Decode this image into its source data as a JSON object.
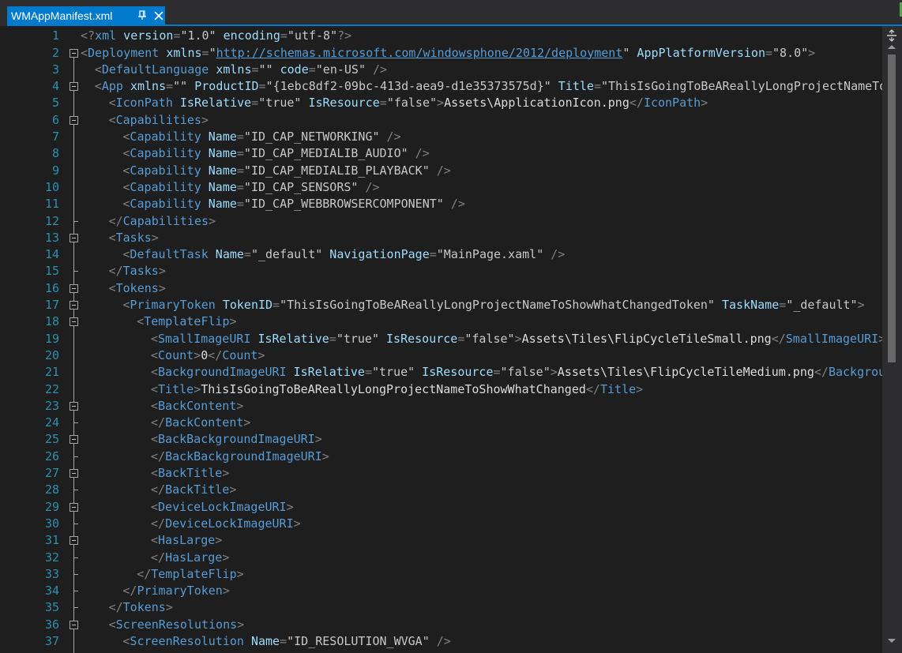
{
  "tab": {
    "title": "WMAppManifest.xml",
    "pin_icon": "pin-icon",
    "close_icon": "close-icon"
  },
  "colors": {
    "accent": "#007acc",
    "tag": "#569cd6",
    "attribute": "#9cdcfe",
    "delimiter": "#808080",
    "line_number": "#2b91af",
    "background": "#1e1e1e"
  },
  "editor": {
    "lines": [
      {
        "n": "1",
        "indent": 0,
        "fold": "",
        "tokens": [
          [
            "d",
            "<?"
          ],
          [
            "t",
            "xml"
          ],
          [
            "a",
            " version"
          ],
          [
            "d",
            "="
          ],
          [
            "s",
            "\"1.0\""
          ],
          [
            "a",
            " encoding"
          ],
          [
            "d",
            "="
          ],
          [
            "s",
            "\"utf-8\""
          ],
          [
            "d",
            "?>"
          ]
        ]
      },
      {
        "n": "2",
        "indent": 0,
        "fold": "open",
        "tokens": [
          [
            "d",
            "<"
          ],
          [
            "t",
            "Deployment"
          ],
          [
            "a",
            " xmlns"
          ],
          [
            "d",
            "="
          ],
          [
            "s",
            "\""
          ],
          [
            "u",
            "http://schemas.microsoft.com/windowsphone/2012/deployment"
          ],
          [
            "s",
            "\""
          ],
          [
            "a",
            " AppPlatformVersion"
          ],
          [
            "d",
            "="
          ],
          [
            "s",
            "\"8.0\""
          ],
          [
            "d",
            ">"
          ]
        ]
      },
      {
        "n": "3",
        "indent": 1,
        "fold": "",
        "tokens": [
          [
            "d",
            "<"
          ],
          [
            "t",
            "DefaultLanguage"
          ],
          [
            "a",
            " xmlns"
          ],
          [
            "d",
            "="
          ],
          [
            "s",
            "\"\""
          ],
          [
            "a",
            " code"
          ],
          [
            "d",
            "="
          ],
          [
            "s",
            "\"en-US\""
          ],
          [
            "d",
            " />"
          ]
        ]
      },
      {
        "n": "4",
        "indent": 1,
        "fold": "open",
        "tokens": [
          [
            "d",
            "<"
          ],
          [
            "t",
            "App"
          ],
          [
            "a",
            " xmlns"
          ],
          [
            "d",
            "="
          ],
          [
            "s",
            "\"\""
          ],
          [
            "a",
            " ProductID"
          ],
          [
            "d",
            "="
          ],
          [
            "s",
            "\"{1ebc8df2-09bc-413d-aea9-d1e35373575d}\""
          ],
          [
            "a",
            " Title"
          ],
          [
            "d",
            "="
          ],
          [
            "s",
            "\"ThisIsGoingToBeAReallyLongProjectNameToShowWhatChanged\""
          ]
        ]
      },
      {
        "n": "5",
        "indent": 2,
        "fold": "",
        "tokens": [
          [
            "d",
            "<"
          ],
          [
            "t",
            "IconPath"
          ],
          [
            "a",
            " IsRelative"
          ],
          [
            "d",
            "="
          ],
          [
            "s",
            "\"true\""
          ],
          [
            "a",
            " IsResource"
          ],
          [
            "d",
            "="
          ],
          [
            "s",
            "\"false\""
          ],
          [
            "d",
            ">"
          ],
          [
            "x",
            "Assets\\ApplicationIcon.png"
          ],
          [
            "d",
            "</"
          ],
          [
            "t",
            "IconPath"
          ],
          [
            "d",
            ">"
          ]
        ]
      },
      {
        "n": "6",
        "indent": 2,
        "fold": "open",
        "tokens": [
          [
            "d",
            "<"
          ],
          [
            "t",
            "Capabilities"
          ],
          [
            "d",
            ">"
          ]
        ]
      },
      {
        "n": "7",
        "indent": 3,
        "fold": "",
        "tokens": [
          [
            "d",
            "<"
          ],
          [
            "t",
            "Capability"
          ],
          [
            "a",
            " Name"
          ],
          [
            "d",
            "="
          ],
          [
            "s",
            "\"ID_CAP_NETWORKING\""
          ],
          [
            "d",
            " />"
          ]
        ]
      },
      {
        "n": "8",
        "indent": 3,
        "fold": "",
        "tokens": [
          [
            "d",
            "<"
          ],
          [
            "t",
            "Capability"
          ],
          [
            "a",
            " Name"
          ],
          [
            "d",
            "="
          ],
          [
            "s",
            "\"ID_CAP_MEDIALIB_AUDIO\""
          ],
          [
            "d",
            " />"
          ]
        ]
      },
      {
        "n": "9",
        "indent": 3,
        "fold": "",
        "tokens": [
          [
            "d",
            "<"
          ],
          [
            "t",
            "Capability"
          ],
          [
            "a",
            " Name"
          ],
          [
            "d",
            "="
          ],
          [
            "s",
            "\"ID_CAP_MEDIALIB_PLAYBACK\""
          ],
          [
            "d",
            " />"
          ]
        ]
      },
      {
        "n": "10",
        "indent": 3,
        "fold": "",
        "tokens": [
          [
            "d",
            "<"
          ],
          [
            "t",
            "Capability"
          ],
          [
            "a",
            " Name"
          ],
          [
            "d",
            "="
          ],
          [
            "s",
            "\"ID_CAP_SENSORS\""
          ],
          [
            "d",
            " />"
          ]
        ]
      },
      {
        "n": "11",
        "indent": 3,
        "fold": "",
        "tokens": [
          [
            "d",
            "<"
          ],
          [
            "t",
            "Capability"
          ],
          [
            "a",
            " Name"
          ],
          [
            "d",
            "="
          ],
          [
            "s",
            "\"ID_CAP_WEBBROWSERCOMPONENT\""
          ],
          [
            "d",
            " />"
          ]
        ]
      },
      {
        "n": "12",
        "indent": 2,
        "fold": "end",
        "tokens": [
          [
            "d",
            "</"
          ],
          [
            "t",
            "Capabilities"
          ],
          [
            "d",
            ">"
          ]
        ]
      },
      {
        "n": "13",
        "indent": 2,
        "fold": "open",
        "tokens": [
          [
            "d",
            "<"
          ],
          [
            "t",
            "Tasks"
          ],
          [
            "d",
            ">"
          ]
        ]
      },
      {
        "n": "14",
        "indent": 3,
        "fold": "",
        "tokens": [
          [
            "d",
            "<"
          ],
          [
            "t",
            "DefaultTask"
          ],
          [
            "a",
            " Name"
          ],
          [
            "d",
            "="
          ],
          [
            "s",
            "\"_default\""
          ],
          [
            "a",
            " NavigationPage"
          ],
          [
            "d",
            "="
          ],
          [
            "s",
            "\"MainPage.xaml\""
          ],
          [
            "d",
            " />"
          ]
        ]
      },
      {
        "n": "15",
        "indent": 2,
        "fold": "end",
        "tokens": [
          [
            "d",
            "</"
          ],
          [
            "t",
            "Tasks"
          ],
          [
            "d",
            ">"
          ]
        ]
      },
      {
        "n": "16",
        "indent": 2,
        "fold": "open",
        "tokens": [
          [
            "d",
            "<"
          ],
          [
            "t",
            "Tokens"
          ],
          [
            "d",
            ">"
          ]
        ]
      },
      {
        "n": "17",
        "indent": 3,
        "fold": "open",
        "tokens": [
          [
            "d",
            "<"
          ],
          [
            "t",
            "PrimaryToken"
          ],
          [
            "a",
            " TokenID"
          ],
          [
            "d",
            "="
          ],
          [
            "s",
            "\"ThisIsGoingToBeAReallyLongProjectNameToShowWhatChangedToken\""
          ],
          [
            "a",
            " TaskName"
          ],
          [
            "d",
            "="
          ],
          [
            "s",
            "\"_default\""
          ],
          [
            "d",
            ">"
          ]
        ]
      },
      {
        "n": "18",
        "indent": 4,
        "fold": "open",
        "tokens": [
          [
            "d",
            "<"
          ],
          [
            "t",
            "TemplateFlip"
          ],
          [
            "d",
            ">"
          ]
        ]
      },
      {
        "n": "19",
        "indent": 5,
        "fold": "",
        "tokens": [
          [
            "d",
            "<"
          ],
          [
            "t",
            "SmallImageURI"
          ],
          [
            "a",
            " IsRelative"
          ],
          [
            "d",
            "="
          ],
          [
            "s",
            "\"true\""
          ],
          [
            "a",
            " IsResource"
          ],
          [
            "d",
            "="
          ],
          [
            "s",
            "\"false\""
          ],
          [
            "d",
            ">"
          ],
          [
            "x",
            "Assets\\Tiles\\FlipCycleTileSmall.png"
          ],
          [
            "d",
            "</"
          ],
          [
            "t",
            "SmallImageURI"
          ],
          [
            "d",
            ">"
          ]
        ]
      },
      {
        "n": "20",
        "indent": 5,
        "fold": "",
        "tokens": [
          [
            "d",
            "<"
          ],
          [
            "t",
            "Count"
          ],
          [
            "d",
            ">"
          ],
          [
            "x",
            "0"
          ],
          [
            "d",
            "</"
          ],
          [
            "t",
            "Count"
          ],
          [
            "d",
            ">"
          ]
        ]
      },
      {
        "n": "21",
        "indent": 5,
        "fold": "",
        "tokens": [
          [
            "d",
            "<"
          ],
          [
            "t",
            "BackgroundImageURI"
          ],
          [
            "a",
            " IsRelative"
          ],
          [
            "d",
            "="
          ],
          [
            "s",
            "\"true\""
          ],
          [
            "a",
            " IsResource"
          ],
          [
            "d",
            "="
          ],
          [
            "s",
            "\"false\""
          ],
          [
            "d",
            ">"
          ],
          [
            "x",
            "Assets\\Tiles\\FlipCycleTileMedium.png"
          ],
          [
            "d",
            "</"
          ],
          [
            "t",
            "BackgroundImageURI"
          ],
          [
            "d",
            ">"
          ]
        ]
      },
      {
        "n": "22",
        "indent": 5,
        "fold": "",
        "tokens": [
          [
            "d",
            "<"
          ],
          [
            "t",
            "Title"
          ],
          [
            "d",
            ">"
          ],
          [
            "x",
            "ThisIsGoingToBeAReallyLongProjectNameToShowWhatChanged"
          ],
          [
            "d",
            "</"
          ],
          [
            "t",
            "Title"
          ],
          [
            "d",
            ">"
          ]
        ]
      },
      {
        "n": "23",
        "indent": 5,
        "fold": "open",
        "tokens": [
          [
            "d",
            "<"
          ],
          [
            "t",
            "BackContent"
          ],
          [
            "d",
            ">"
          ]
        ]
      },
      {
        "n": "24",
        "indent": 5,
        "fold": "end",
        "tokens": [
          [
            "d",
            "</"
          ],
          [
            "t",
            "BackContent"
          ],
          [
            "d",
            ">"
          ]
        ]
      },
      {
        "n": "25",
        "indent": 5,
        "fold": "open",
        "tokens": [
          [
            "d",
            "<"
          ],
          [
            "t",
            "BackBackgroundImageURI"
          ],
          [
            "d",
            ">"
          ]
        ]
      },
      {
        "n": "26",
        "indent": 5,
        "fold": "end",
        "tokens": [
          [
            "d",
            "</"
          ],
          [
            "t",
            "BackBackgroundImageURI"
          ],
          [
            "d",
            ">"
          ]
        ]
      },
      {
        "n": "27",
        "indent": 5,
        "fold": "open",
        "tokens": [
          [
            "d",
            "<"
          ],
          [
            "t",
            "BackTitle"
          ],
          [
            "d",
            ">"
          ]
        ]
      },
      {
        "n": "28",
        "indent": 5,
        "fold": "end",
        "tokens": [
          [
            "d",
            "</"
          ],
          [
            "t",
            "BackTitle"
          ],
          [
            "d",
            ">"
          ]
        ]
      },
      {
        "n": "29",
        "indent": 5,
        "fold": "open",
        "tokens": [
          [
            "d",
            "<"
          ],
          [
            "t",
            "DeviceLockImageURI"
          ],
          [
            "d",
            ">"
          ]
        ]
      },
      {
        "n": "30",
        "indent": 5,
        "fold": "end",
        "tokens": [
          [
            "d",
            "</"
          ],
          [
            "t",
            "DeviceLockImageURI"
          ],
          [
            "d",
            ">"
          ]
        ]
      },
      {
        "n": "31",
        "indent": 5,
        "fold": "open",
        "tokens": [
          [
            "d",
            "<"
          ],
          [
            "t",
            "HasLarge"
          ],
          [
            "d",
            ">"
          ]
        ]
      },
      {
        "n": "32",
        "indent": 5,
        "fold": "end",
        "tokens": [
          [
            "d",
            "</"
          ],
          [
            "t",
            "HasLarge"
          ],
          [
            "d",
            ">"
          ]
        ]
      },
      {
        "n": "33",
        "indent": 4,
        "fold": "end",
        "tokens": [
          [
            "d",
            "</"
          ],
          [
            "t",
            "TemplateFlip"
          ],
          [
            "d",
            ">"
          ]
        ]
      },
      {
        "n": "34",
        "indent": 3,
        "fold": "end",
        "tokens": [
          [
            "d",
            "</"
          ],
          [
            "t",
            "PrimaryToken"
          ],
          [
            "d",
            ">"
          ]
        ]
      },
      {
        "n": "35",
        "indent": 2,
        "fold": "end",
        "tokens": [
          [
            "d",
            "</"
          ],
          [
            "t",
            "Tokens"
          ],
          [
            "d",
            ">"
          ]
        ]
      },
      {
        "n": "36",
        "indent": 2,
        "fold": "open",
        "tokens": [
          [
            "d",
            "<"
          ],
          [
            "t",
            "ScreenResolutions"
          ],
          [
            "d",
            ">"
          ]
        ]
      },
      {
        "n": "37",
        "indent": 3,
        "fold": "",
        "tokens": [
          [
            "d",
            "<"
          ],
          [
            "t",
            "ScreenResolution"
          ],
          [
            "a",
            " Name"
          ],
          [
            "d",
            "="
          ],
          [
            "s",
            "\"ID_RESOLUTION_WVGA\""
          ],
          [
            "d",
            " />"
          ]
        ]
      }
    ]
  },
  "scrollbar": {
    "split_icon": "split-view-icon"
  }
}
